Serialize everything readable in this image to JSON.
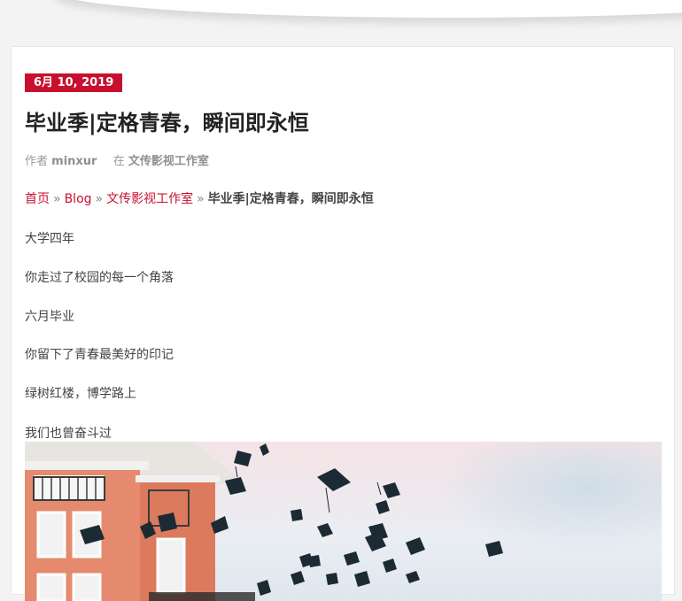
{
  "post": {
    "date": "6月 10, 2019",
    "title": "毕业季|定格青春，瞬间即永恒",
    "meta": {
      "author_prefix": "作者",
      "author": "minxur",
      "category_prefix": "在",
      "category": "文传影视工作室"
    },
    "breadcrumb": {
      "home": "首页",
      "blog": "Blog",
      "category": "文传影视工作室",
      "current": "毕业季|定格青春，瞬间即永恒",
      "separator": "»"
    },
    "paragraphs": [
      "大学四年",
      "你走过了校园的每一个角落",
      "六月毕业",
      "你留下了青春最美好的印记",
      "绿树红楼，博学路上",
      "我们也曾奋斗过"
    ]
  },
  "colors": {
    "accent": "#c8102e",
    "text": "#444444",
    "title": "#222222",
    "meta": "#999999"
  }
}
